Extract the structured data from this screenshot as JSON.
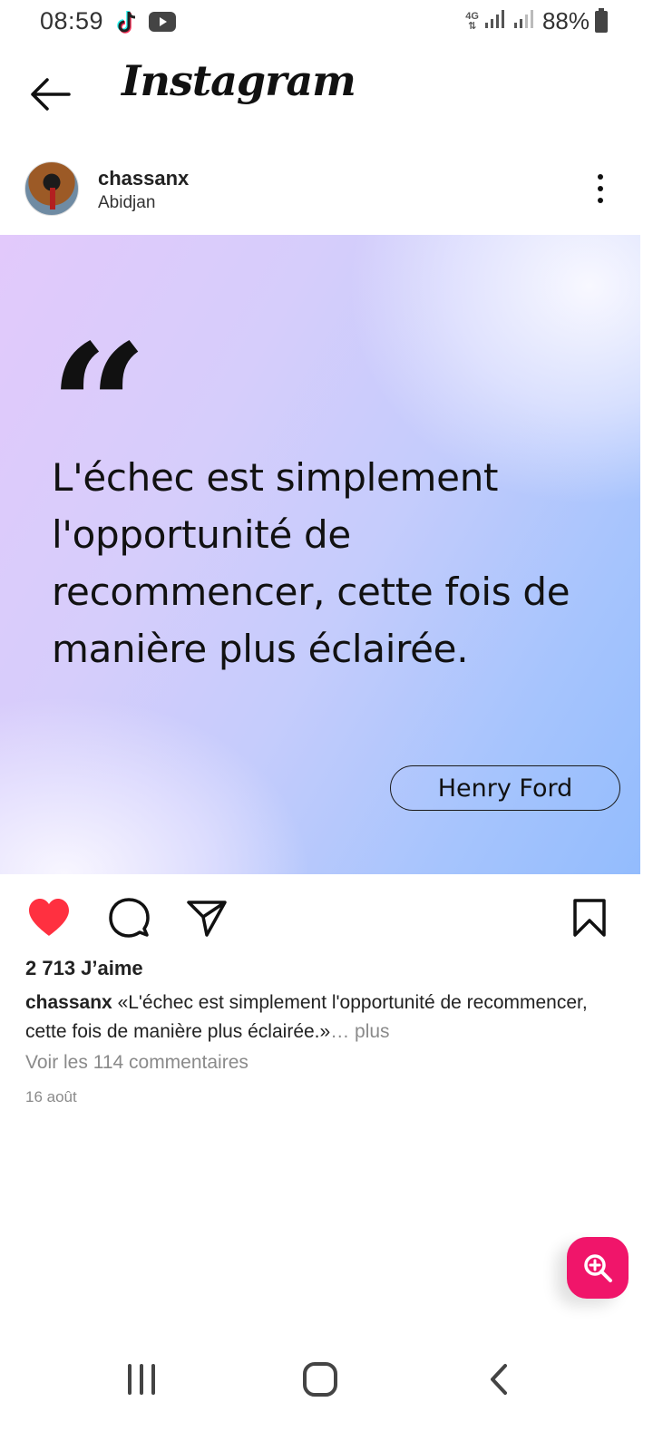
{
  "status_bar": {
    "time": "08:59",
    "app_icons": [
      "tiktok-icon",
      "youtube-icon"
    ],
    "network": "4G",
    "battery": "88%"
  },
  "header": {
    "title": "Instagram",
    "back_icon": "arrow-left-icon"
  },
  "post": {
    "username": "chassanx",
    "location": "Abidjan",
    "image": {
      "quote_mark": "“",
      "quote_text": "L'échec est simplement l'opportunité de recommencer, cette fois de manière plus éclairée.",
      "author": "Henry Ford"
    },
    "actions": {
      "like_icon": "heart-filled-icon",
      "like_color": "#ff3040",
      "comment_icon": "comment-icon",
      "share_icon": "send-icon",
      "save_icon": "bookmark-icon"
    },
    "likes": "2 713 J’aime",
    "caption_user": "chassanx",
    "caption_text": " «L'échec est simplement l'opportunité de recommencer, cette fois de manière plus éclairée.»",
    "caption_more": "… plus",
    "comments_link": "Voir les 114 commentaires",
    "date": "16 août"
  },
  "fab": {
    "icon": "zoom-in-icon",
    "color": "#f0156a"
  },
  "nav_bar": {
    "items": [
      "recent-apps-icon",
      "home-icon",
      "back-icon"
    ]
  }
}
